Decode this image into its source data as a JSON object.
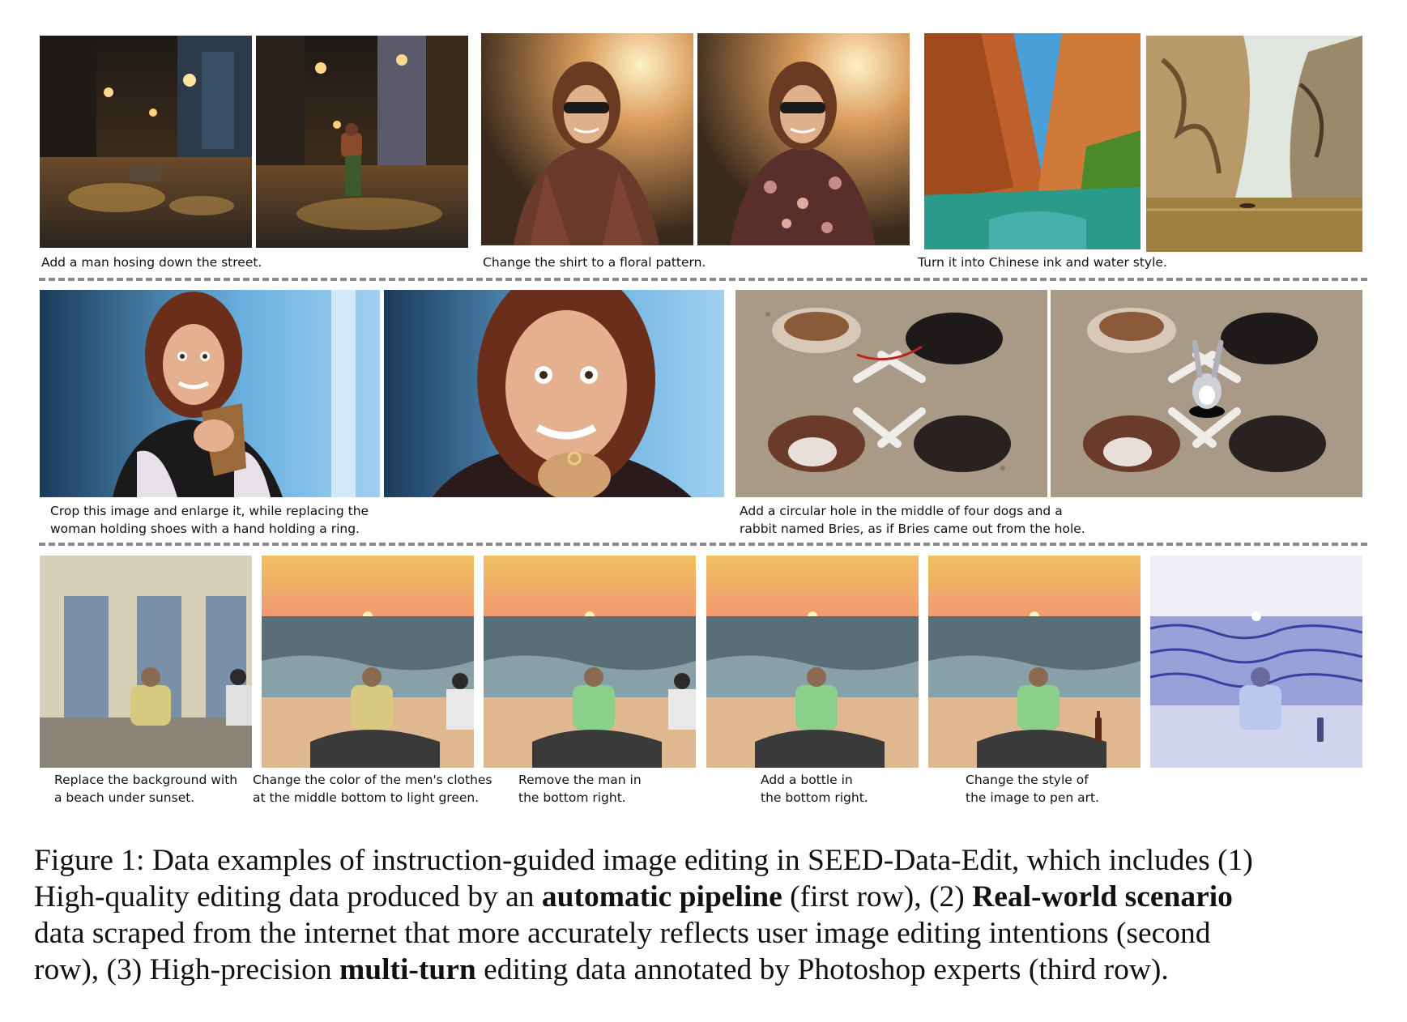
{
  "row1": {
    "panels": [
      {
        "name": "flooded street at night"
      },
      {
        "name": "man hosing down the street"
      },
      {
        "name": "woman in plaid shirt"
      },
      {
        "name": "woman in floral shirt"
      },
      {
        "name": "red canyon river"
      },
      {
        "name": "chinese ink canyon"
      }
    ],
    "captions": [
      "Add a man hosing down the street.",
      "Change the shirt to a floral pattern.",
      "Turn it into Chinese ink and water style."
    ]
  },
  "row2": {
    "captions": [
      {
        "line1": "Crop this image and enlarge it, while replacing the",
        "line2": "woman holding shoes with a hand holding a ring."
      },
      {
        "line1": "Add a circular hole in the middle of four dogs and a",
        "line2": "rabbit named Bries, as if Bries came out from the hole."
      }
    ]
  },
  "row3": {
    "captions": [
      {
        "line1": "Replace the background with",
        "line2": "a beach under sunset."
      },
      {
        "line1": "Change the color of the men's clothes",
        "line2": "at the middle bottom to light green."
      },
      {
        "line1": "Remove the man in",
        "line2": "the bottom right."
      },
      {
        "line1": "Add a bottle in",
        "line2": "the bottom right."
      },
      {
        "line1": "Change the style of",
        "line2": "the image to pen art."
      }
    ]
  },
  "figure_caption": {
    "line1": "Figure 1: Data examples of instruction-guided image editing in SEED-Data-Edit, which includes (1)",
    "line2_a": "High-quality editing data produced by an ",
    "line2_b": "automatic pipeline",
    "line2_c": " (first row), (2) ",
    "line2_d": "Real-world scenario",
    "line3": "data scraped from the internet that more accurately reflects user image editing intentions (second",
    "line4_a": "row), (3) High-precision ",
    "line4_b": "multi-turn",
    "line4_c": " editing data annotated by Photoshop experts (third row)."
  },
  "colors": {
    "divider": "#8a8a8a",
    "text": "#111111"
  }
}
